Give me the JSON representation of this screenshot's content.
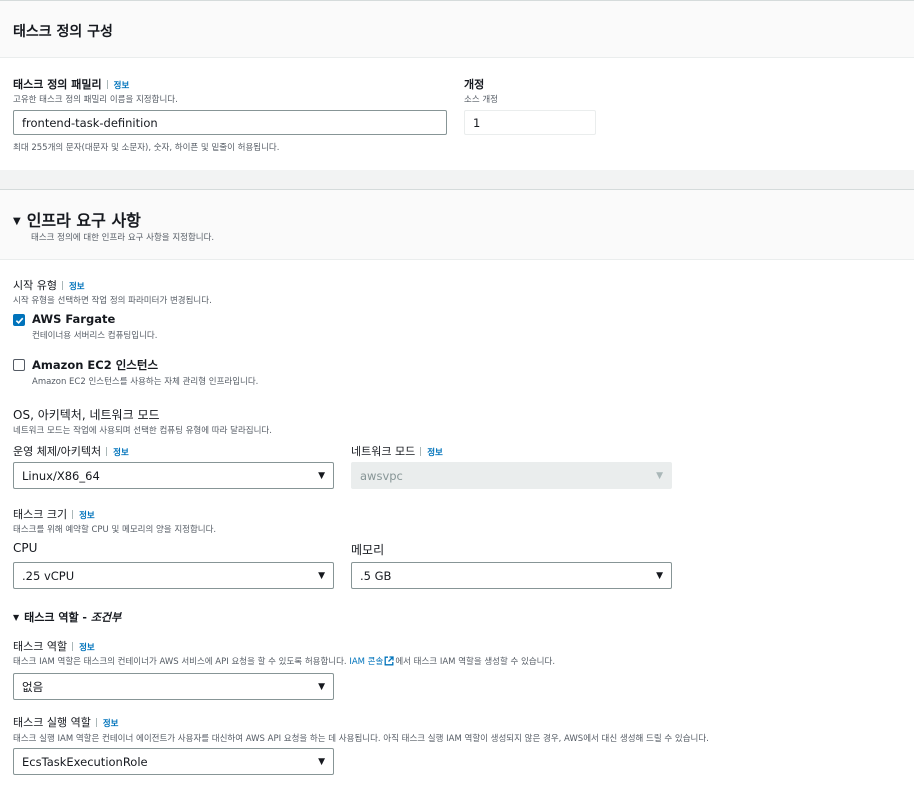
{
  "task_config": {
    "title": "태스크 정의 구성",
    "family_label": "태스크 정의 패밀리",
    "family_info": "정보",
    "family_desc": "고유한 태스크 정의 패밀리 이름을 지정합니다.",
    "family_value": "frontend-task-definition",
    "family_hint": "최대 255개의 문자(대문자 및 소문자), 숫자, 하이픈 및 밑줄이 허용됩니다.",
    "revision_label": "개정",
    "revision_desc": "소스 개정",
    "revision_value": "1"
  },
  "infra": {
    "title": "인프라 요구 사항",
    "collapse_glyph": "▼",
    "desc": "태스크 정의에 대한 인프라 요구 사항을 지정합니다.",
    "launch_type_label": "시작 유형",
    "launch_type_info": "정보",
    "launch_type_desc": "시작 유형을 선택하면 작업 정의 파라미터가 변경됩니다.",
    "fargate_label": "AWS Fargate",
    "fargate_desc": "컨테이너용 서버리스 컴퓨팅입니다.",
    "fargate_checked": true,
    "ec2_label": "Amazon EC2 인스턴스",
    "ec2_desc": "Amazon EC2 인스턴스를 사용하는 자체 관리형 인프라입니다.",
    "ec2_checked": false,
    "os_section_label": "OS, 아키텍처, 네트워크 모드",
    "os_section_desc": "네트워크 모드는 작업에 사용되며 선택한 컴퓨팅 유형에 따라 달라집니다.",
    "os_arch_label": "운영 체제/아키텍처",
    "os_arch_info": "정보",
    "os_arch_value": "Linux/X86_64",
    "network_mode_label": "네트워크 모드",
    "network_mode_info": "정보",
    "network_mode_value": "awsvpc",
    "task_size_label": "태스크 크기",
    "task_size_info": "정보",
    "task_size_desc": "태스크를 위해 예약할 CPU 및 메모리의 양을 지정합니다.",
    "cpu_label": "CPU",
    "cpu_value": ".25 vCPU",
    "memory_label": "메모리",
    "memory_value": ".5 GB",
    "task_role_section": "태스크 역할 - ",
    "task_role_section_em": "조건부",
    "task_role_label": "태스크 역할",
    "task_role_info": "정보",
    "task_role_desc_pre": "태스크 IAM 역할은 태스크의 컨테이너가 AWS 서비스에 API 요청을 할 수 있도록 허용합니다. ",
    "task_role_desc_link": "IAM 콘솔",
    "task_role_desc_post": "에서 태스크 IAM 역할을 생성할 수 있습니다.",
    "task_role_value": "없음",
    "exec_role_label": "태스크 실행 역할",
    "exec_role_info": "정보",
    "exec_role_desc": "태스크 실행 IAM 역할은 컨테이너 에이전트가 사용자를 대신하여 AWS API 요청을 하는 데 사용됩니다. 아직 태스크 실행 IAM 역할이 생성되지 않은 경우, AWS에서 대신 생성해 드릴 수 있습니다.",
    "exec_role_value": "EcsTaskExecutionRole"
  },
  "colors": {
    "accent": "#0073bb",
    "link": "#0073bb",
    "text": "#16191f",
    "muted": "#545b64"
  },
  "glyphs": {
    "caret": "▼"
  }
}
